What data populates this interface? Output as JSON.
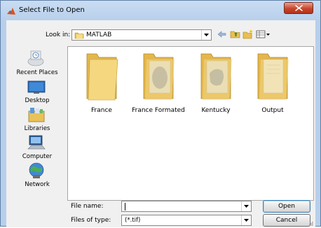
{
  "window": {
    "title": "Select File to Open"
  },
  "lookin": {
    "label": "Look in:",
    "value": "MATLAB"
  },
  "toolbar": {
    "back_icon": "back-arrow-icon",
    "up_icon": "up-folder-icon",
    "new_folder_icon": "new-folder-icon",
    "view_icon": "view-menu-icon"
  },
  "places": [
    {
      "label": "Recent Places",
      "icon": "recent-places-icon"
    },
    {
      "label": "Desktop",
      "icon": "desktop-icon"
    },
    {
      "label": "Libraries",
      "icon": "libraries-icon"
    },
    {
      "label": "Computer",
      "icon": "computer-icon"
    },
    {
      "label": "Network",
      "icon": "network-icon"
    }
  ],
  "files": [
    {
      "name": "France",
      "icon": "folder-icon"
    },
    {
      "name": "France Formated",
      "icon": "folder-icon"
    },
    {
      "name": "Kentucky",
      "icon": "folder-icon"
    },
    {
      "name": "Output",
      "icon": "folder-icon"
    }
  ],
  "filename": {
    "label": "File name:",
    "value": ""
  },
  "filetype": {
    "label": "Files of type:",
    "value": "(*.tif)"
  },
  "buttons": {
    "open": "Open",
    "cancel": "Cancel"
  },
  "colors": {
    "title_bar": "#b7cfeb",
    "close_button": "#c9452b",
    "folder": "#f2cf6a"
  }
}
